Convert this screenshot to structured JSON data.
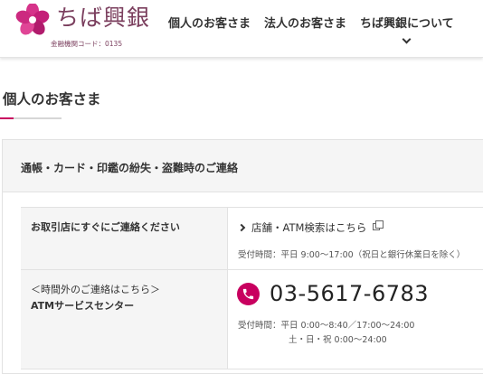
{
  "header": {
    "logo_text": "ちば興銀",
    "bank_code": "金融機関コード：0135",
    "nav": [
      {
        "label": "個人のお客さま"
      },
      {
        "label": "法人のお客さま"
      },
      {
        "label": "ちば興銀について"
      }
    ]
  },
  "page": {
    "title": "個人のお客さま"
  },
  "panel": {
    "heading": "通帳・カード・印鑑の紛失・盗難時のご連絡",
    "rows": [
      {
        "label": "お取引店にすぐにご連絡ください",
        "link_text": "店舗・ATM検索はこちら",
        "hours": "受付時間：平日 9:00〜17:00（祝日と銀行休業日を除く）"
      },
      {
        "label_line1": "＜時間外のご連絡はこちら＞",
        "label_line2": "ATMサービスセンター",
        "phone": "03-5617-6783",
        "hours_line1": "受付時間：平日 0:00〜8:40／17:00〜24:00",
        "hours_line2": "土・日・祝 0:00〜24:00"
      }
    ]
  },
  "colors": {
    "brand": "#7b3f5e",
    "accent": "#c8005f",
    "panel_bg": "#f5f5f5"
  },
  "icons": {
    "logo": "flower-logo-icon",
    "nav_dropdown": "chevron-down-icon",
    "link": "chevron-right-icon",
    "external": "external-window-icon",
    "phone": "phone-icon"
  }
}
